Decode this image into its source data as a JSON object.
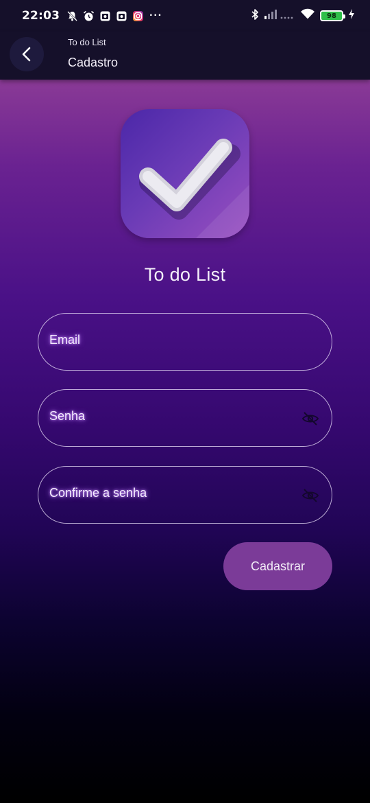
{
  "status_bar": {
    "time": "22:03",
    "left_icons": [
      "mute-icon",
      "alarm-icon",
      "app-notification-icon",
      "app-notification-icon",
      "instagram-icon"
    ],
    "more": "···",
    "right_icons": [
      "bluetooth-icon",
      "signal-icon",
      "wifi-icon",
      "battery-icon",
      "charging-icon"
    ],
    "battery_level": "98"
  },
  "app_bar": {
    "subtitle": "To do List",
    "title": "Cadastro",
    "back_icon": "chevron-left-icon"
  },
  "logo": {
    "icon": "checkmark-icon"
  },
  "app_name": "To do List",
  "form": {
    "email_label": "Email",
    "password_label": "Senha",
    "confirm_password_label": "Confirme a senha",
    "visibility_icon": "eye-off-icon",
    "submit_label": "Cadastrar"
  },
  "colors": {
    "app_bar": "#15102a",
    "button": "#7b3b98",
    "gradient_top": "#8a3a96",
    "gradient_bottom": "#000000"
  }
}
